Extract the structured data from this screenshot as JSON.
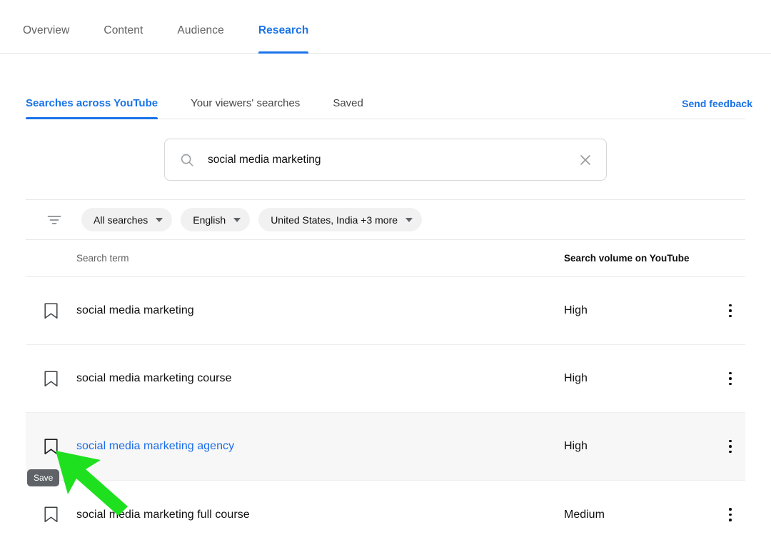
{
  "top_nav": {
    "tabs": [
      {
        "label": "Overview",
        "active": false
      },
      {
        "label": "Content",
        "active": false
      },
      {
        "label": "Audience",
        "active": false
      },
      {
        "label": "Research",
        "active": true
      }
    ]
  },
  "sub_nav": {
    "tabs": [
      {
        "label": "Searches across YouTube",
        "active": true
      },
      {
        "label": "Your viewers' searches",
        "active": false
      },
      {
        "label": "Saved",
        "active": false
      }
    ],
    "send_feedback_label": "Send feedback"
  },
  "search": {
    "value": "social media marketing",
    "placeholder": "Search",
    "search_icon": "search-icon",
    "clear_icon": "close-icon"
  },
  "filters": {
    "filter_icon": "filter-list-icon",
    "chips": [
      {
        "label": "All searches"
      },
      {
        "label": "English"
      },
      {
        "label": "United States, India +3 more"
      }
    ]
  },
  "table": {
    "columns": [
      "Search term",
      "Search volume on YouTube"
    ],
    "rows": [
      {
        "term": "social media marketing",
        "volume": "High",
        "highlight": false,
        "link": false
      },
      {
        "term": "social media marketing course",
        "volume": "High",
        "highlight": false,
        "link": false
      },
      {
        "term": "social media marketing agency",
        "volume": "High",
        "highlight": true,
        "link": true
      },
      {
        "term": "social media marketing full course",
        "volume": "Medium",
        "highlight": false,
        "link": false
      }
    ],
    "bookmark_icon": "bookmark-icon",
    "more_icon": "more-vertical-icon"
  },
  "annotation": {
    "tooltip_label": "Save",
    "arrow_color": "#1ee01e"
  },
  "colors": {
    "accent_blue": "#1a73e8",
    "link_blue": "#1a6ce8",
    "text": "#0f0f0f",
    "muted": "#606060",
    "row_highlight": "#f7f7f7",
    "chip_bg": "#f1f1f1",
    "tooltip_bg": "#5f6368"
  }
}
